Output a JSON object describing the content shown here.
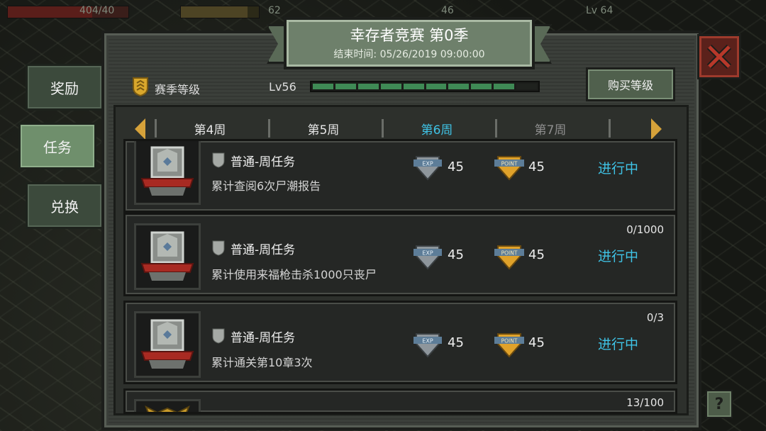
{
  "hud": {
    "left_value": "404/40",
    "mid_value": "62",
    "right_value": "46",
    "level_value": "Lv 64"
  },
  "title": {
    "main": "幸存者竞赛 第0季",
    "sub": "结束时间: 05/26/2019 09:00:00"
  },
  "side_tabs": [
    {
      "label": "奖励"
    },
    {
      "label": "任务"
    },
    {
      "label": "兑换"
    }
  ],
  "season": {
    "label": "赛季等级",
    "level": "Lv56",
    "progress_segments_filled": 9,
    "progress_segments_total": 10,
    "buy_label": "购买等级"
  },
  "weeks": [
    {
      "label": "第4周"
    },
    {
      "label": "第5周"
    },
    {
      "label": "第6周"
    },
    {
      "label": "第7周"
    }
  ],
  "tasks": [
    {
      "type": "普通-周任务",
      "desc": "累计查阅6次尸潮报告",
      "exp": "45",
      "point": "45",
      "status": "进行中",
      "progress": ""
    },
    {
      "type": "普通-周任务",
      "desc": "累计使用来福枪击杀1000只丧尸",
      "exp": "45",
      "point": "45",
      "status": "进行中",
      "progress": "0/1000"
    },
    {
      "type": "普通-周任务",
      "desc": "累计通关第10章3次",
      "exp": "45",
      "point": "45",
      "status": "进行中",
      "progress": "0/3"
    },
    {
      "type": "",
      "desc": "",
      "exp": "",
      "point": "",
      "status": "",
      "progress": "13/100"
    }
  ],
  "icons": {
    "exp_badge": "EXP",
    "point_badge": "POINT",
    "help": "?"
  },
  "colors": {
    "active_tab_text": "#3fc3e6",
    "status_text": "#3fc3e6",
    "level_fill": "#3f8a55",
    "close_red": "#9e3a2c"
  }
}
